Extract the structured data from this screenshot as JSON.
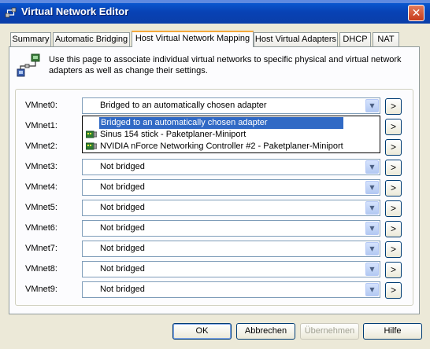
{
  "window": {
    "title": "Virtual Network Editor",
    "close_label": "✕"
  },
  "tabs": [
    {
      "label": "Summary"
    },
    {
      "label": "Automatic Bridging"
    },
    {
      "label": "Host Virtual Network Mapping"
    },
    {
      "label": "Host Virtual Adapters"
    },
    {
      "label": "DHCP"
    },
    {
      "label": "NAT"
    }
  ],
  "active_tab": "Host Virtual Network Mapping",
  "info": {
    "text": "Use this page to associate individual virtual networks to specific physical and virtual network adapters as well as change their settings."
  },
  "vmnets": [
    {
      "label": "VMnet0:",
      "value": "Bridged to an automatically chosen adapter"
    },
    {
      "label": "VMnet1:",
      "value": ""
    },
    {
      "label": "VMnet2:",
      "value": ""
    },
    {
      "label": "VMnet3:",
      "value": "Not bridged"
    },
    {
      "label": "VMnet4:",
      "value": "Not bridged"
    },
    {
      "label": "VMnet5:",
      "value": "Not bridged"
    },
    {
      "label": "VMnet6:",
      "value": "Not bridged"
    },
    {
      "label": "VMnet7:",
      "value": "Not bridged"
    },
    {
      "label": "VMnet8:",
      "value": "Not bridged"
    },
    {
      "label": "VMnet9:",
      "value": "Not bridged"
    }
  ],
  "more_label": ">",
  "dropdown": {
    "options": [
      {
        "label": "Bridged to an automatically chosen adapter",
        "icon": "none",
        "selected": true
      },
      {
        "label": "Sinus 154 stick - Paketplaner-Miniport",
        "icon": "network-card-icon",
        "selected": false
      },
      {
        "label": "NVIDIA nForce Networking Controller #2 - Paketplaner-Miniport",
        "icon": "network-card-icon",
        "selected": false
      }
    ]
  },
  "buttons": {
    "ok": "OK",
    "cancel": "Abbrechen",
    "apply": "Übernehmen",
    "help": "Hilfe"
  },
  "colors": {
    "titlebar": "#0842b5",
    "selection": "#316ac5",
    "active_tab_accent": "#f5a93a"
  }
}
